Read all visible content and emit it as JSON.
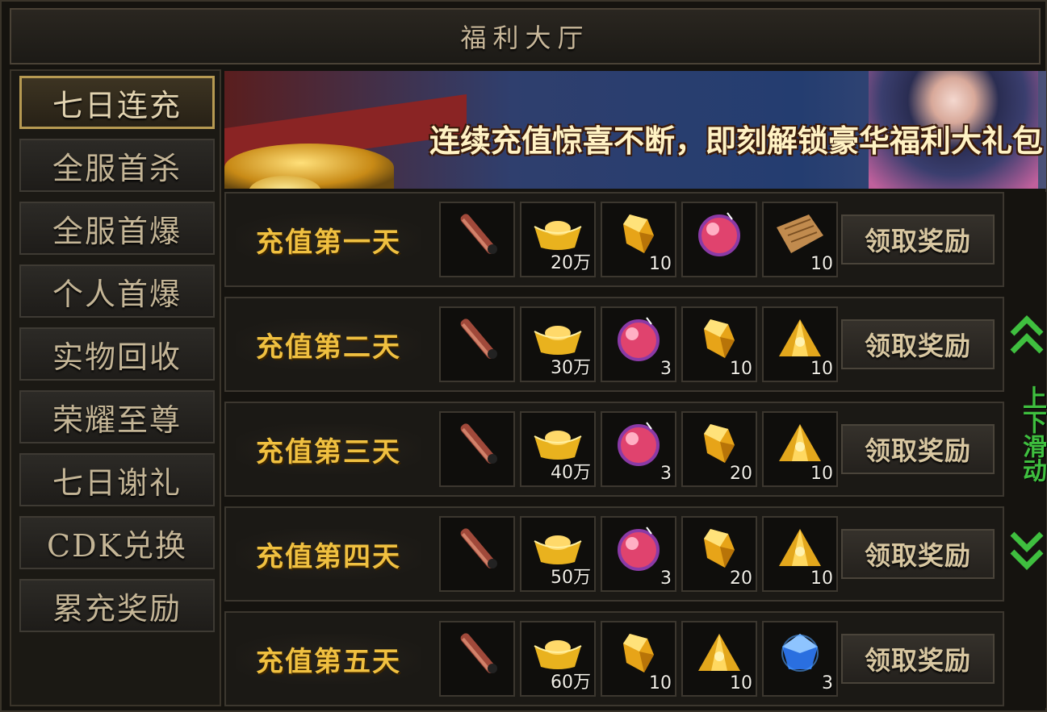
{
  "title": "福利大厅",
  "sidebar": {
    "items": [
      {
        "label": "七日连充",
        "active": true
      },
      {
        "label": "全服首杀",
        "active": false
      },
      {
        "label": "全服首爆",
        "active": false
      },
      {
        "label": "个人首爆",
        "active": false
      },
      {
        "label": "实物回收",
        "active": false
      },
      {
        "label": "荣耀至尊",
        "active": false
      },
      {
        "label": "七日谢礼",
        "active": false
      },
      {
        "label": "CDK兑换",
        "active": false
      },
      {
        "label": "累充奖励",
        "active": false
      }
    ]
  },
  "banner": {
    "slogan": "连续充值惊喜不断，即刻解锁豪华福利大礼包"
  },
  "rows": [
    {
      "label": "充值第一天",
      "claim_label": "领取奖励",
      "items": [
        {
          "icon": "scroll-tube-icon",
          "count": ""
        },
        {
          "icon": "gold-ingot-icon",
          "count": "20万"
        },
        {
          "icon": "gold-crystal-icon",
          "count": "10"
        },
        {
          "icon": "red-orb-icon",
          "count": ""
        },
        {
          "icon": "parchment-icon",
          "count": "10"
        }
      ]
    },
    {
      "label": "充值第二天",
      "claim_label": "领取奖励",
      "items": [
        {
          "icon": "scroll-tube-icon",
          "count": ""
        },
        {
          "icon": "gold-ingot-icon",
          "count": "30万"
        },
        {
          "icon": "red-orb-icon",
          "count": "3"
        },
        {
          "icon": "gold-crystal-icon",
          "count": "10"
        },
        {
          "icon": "gold-pyramid-icon",
          "count": "10"
        }
      ]
    },
    {
      "label": "充值第三天",
      "claim_label": "领取奖励",
      "items": [
        {
          "icon": "scroll-tube-icon",
          "count": ""
        },
        {
          "icon": "gold-ingot-icon",
          "count": "40万"
        },
        {
          "icon": "red-orb-icon",
          "count": "3"
        },
        {
          "icon": "gold-crystal-icon",
          "count": "20"
        },
        {
          "icon": "gold-pyramid-icon",
          "count": "10"
        }
      ]
    },
    {
      "label": "充值第四天",
      "claim_label": "领取奖励",
      "items": [
        {
          "icon": "scroll-tube-icon",
          "count": ""
        },
        {
          "icon": "gold-ingot-icon",
          "count": "50万"
        },
        {
          "icon": "red-orb-icon",
          "count": "3"
        },
        {
          "icon": "gold-crystal-icon",
          "count": "20"
        },
        {
          "icon": "gold-pyramid-icon",
          "count": "10"
        }
      ]
    },
    {
      "label": "充值第五天",
      "claim_label": "领取奖励",
      "items": [
        {
          "icon": "scroll-tube-icon",
          "count": ""
        },
        {
          "icon": "gold-ingot-icon",
          "count": "60万"
        },
        {
          "icon": "gold-crystal-icon",
          "count": "10"
        },
        {
          "icon": "gold-pyramid-icon",
          "count": "10"
        },
        {
          "icon": "blue-gem-icon",
          "count": "3"
        }
      ]
    }
  ],
  "scroll_hint": {
    "text": "上下滑动",
    "up_icon": "double-chevron-up-icon",
    "down_icon": "double-chevron-down-icon",
    "color": "#3fbf3f"
  },
  "colors": {
    "gold_text": "#f0c040",
    "active_border": "#b79a52"
  }
}
